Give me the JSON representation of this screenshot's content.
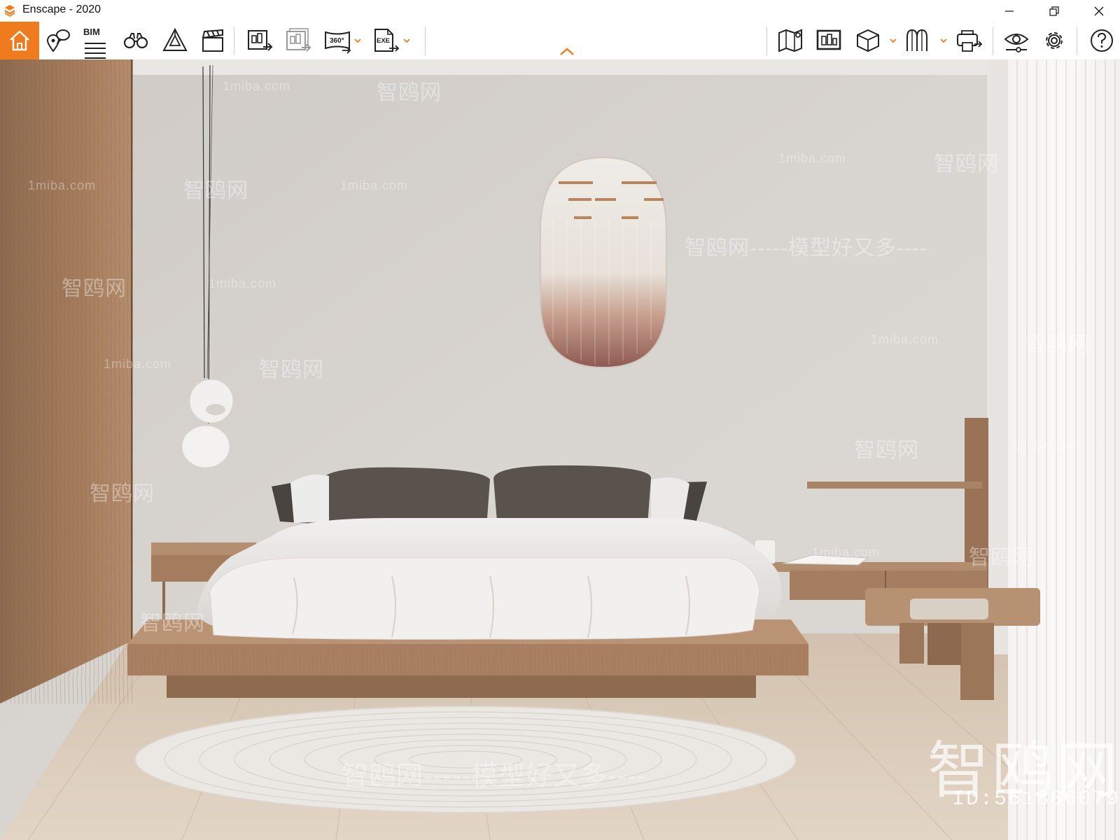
{
  "window": {
    "title": "Enscape - 2020",
    "accent_color": "#f07b1f",
    "controls": [
      "minimize-icon",
      "restore-icon",
      "close-icon"
    ]
  },
  "toolbar": {
    "left_tools": [
      {
        "name": "home",
        "icon": "home-icon",
        "active": true
      },
      {
        "name": "views",
        "icon": "map-pin-bubble-icon"
      },
      {
        "name": "bim",
        "icon": "bim-list-icon",
        "label": "BIM"
      },
      {
        "name": "binoculars",
        "icon": "binoculars-icon"
      },
      {
        "name": "atmosphere",
        "icon": "shape-icon"
      },
      {
        "name": "video",
        "icon": "clapperboard-icon"
      },
      {
        "name": "screenshot",
        "icon": "render-export-icon"
      },
      {
        "name": "batch",
        "icon": "batch-render-icon"
      },
      {
        "name": "panorama",
        "icon": "panorama-icon",
        "label": "360°",
        "dropdown": true
      },
      {
        "name": "exe",
        "icon": "exe-export-icon",
        "label": "EXE",
        "dropdown": true
      }
    ],
    "right_tools": [
      {
        "name": "map",
        "icon": "map-icon"
      },
      {
        "name": "render-view",
        "icon": "render-view-icon"
      },
      {
        "name": "cube",
        "icon": "cube-icon",
        "dropdown": true
      },
      {
        "name": "assets",
        "icon": "asset-library-icon",
        "dropdown": true
      },
      {
        "name": "vr",
        "icon": "vr-headset-icon"
      },
      {
        "name": "visual-settings",
        "icon": "eye-icon"
      },
      {
        "name": "settings",
        "icon": "gear-icon"
      },
      {
        "name": "help",
        "icon": "help-icon"
      }
    ],
    "collapse_icon": "chevron-up-icon"
  },
  "viewport": {
    "scene": "rendered bedroom interior",
    "watermarks": {
      "site": "1miba.com",
      "brand": "智鸥网",
      "slogan": "智鸥网-----模型好又多----",
      "big": "智鸥网",
      "id": "ID:561886079"
    }
  }
}
